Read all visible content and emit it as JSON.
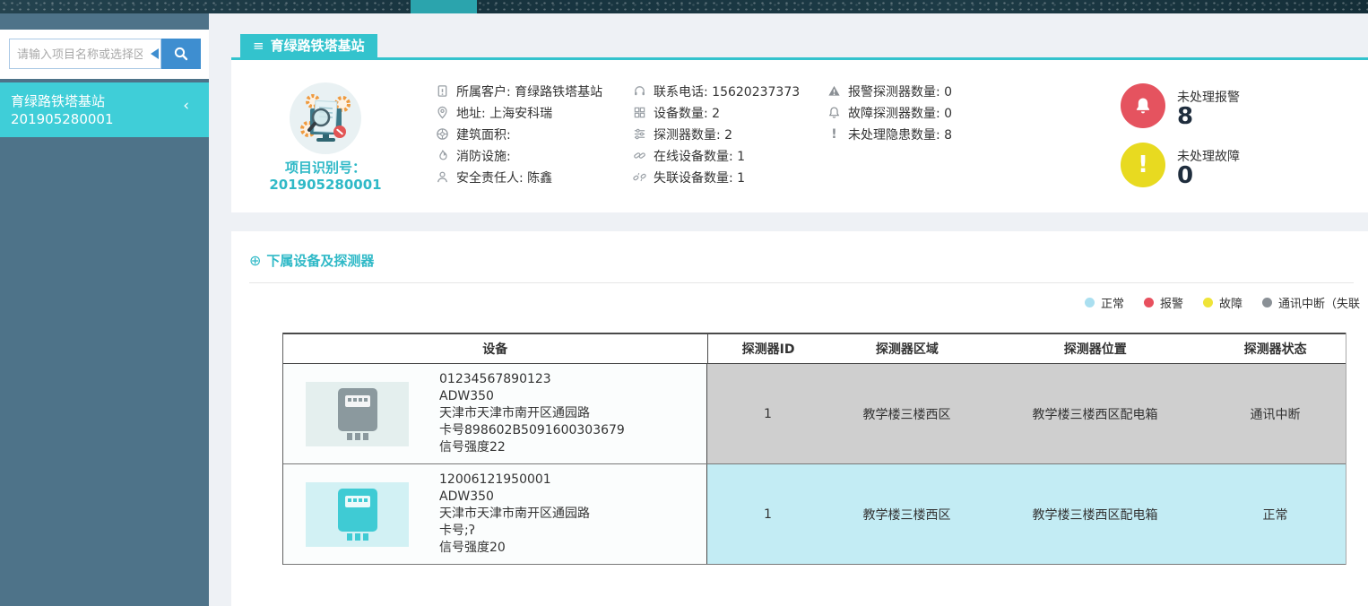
{
  "sidebar": {
    "search_placeholder": "请输入项目名称或选择区",
    "selected_project": {
      "name": "育绿路铁塔基站",
      "code": "201905280001",
      "chevron": "‹"
    }
  },
  "header": {
    "menu_icon": "≡",
    "tab_title": "育绿路铁塔基站"
  },
  "project": {
    "id_label": "项目识别号：",
    "id_value": "201905280001",
    "info_col1": [
      {
        "icon": "id-card-icon",
        "text": "所属客户: 育绿路铁塔基站"
      },
      {
        "icon": "location-pin-icon",
        "text": "地址: 上海安科瑞"
      },
      {
        "icon": "area-wheel-icon",
        "text": "建筑面积:"
      },
      {
        "icon": "fire-icon",
        "text": "消防设施:"
      },
      {
        "icon": "person-icon",
        "text": "安全责任人: 陈鑫"
      }
    ],
    "info_col2": [
      {
        "icon": "headset-icon",
        "text": "联系电话: 15620237373"
      },
      {
        "icon": "grid-icon",
        "text": "设备数量: 2"
      },
      {
        "icon": "sliders-icon",
        "text": "探测器数量: 2"
      },
      {
        "icon": "link-icon",
        "text": "在线设备数量: 1"
      },
      {
        "icon": "broken-link-icon",
        "text": "失联设备数量: 1"
      }
    ],
    "info_col3": [
      {
        "icon": "warning-triangle-icon",
        "text": "报警探测器数量: 0"
      },
      {
        "icon": "bell-outline-icon",
        "text": "故障探测器数量: 0"
      },
      {
        "icon": "exclamation-icon",
        "text": "未处理隐患数量: 8",
        "glyph": "!"
      }
    ]
  },
  "alerts": {
    "alarm_label": "未处理报警",
    "alarm_count": "8",
    "alarm_color": "#e5535f",
    "fault_label": "未处理故障",
    "fault_count": "0",
    "fault_color": "#e8da20",
    "fault_glyph": "!"
  },
  "devices_section": {
    "title": "下属设备及探测器",
    "title_icon": "⊕",
    "legend": [
      {
        "label": "正常",
        "color": "#aadff0"
      },
      {
        "label": "报警",
        "color": "#e8505e"
      },
      {
        "label": "故障",
        "color": "#efe438"
      },
      {
        "label": "通讯中断（失联",
        "color": "#8a9096"
      }
    ],
    "table": {
      "headers": [
        "设备",
        "探测器ID",
        "探测器区域",
        "探测器位置",
        "探测器状态"
      ],
      "rows": [
        {
          "device": {
            "line1": "01234567890123",
            "line2": "ADW350",
            "line3": "天津市天津市南开区通园路",
            "line4": "卡号898602B5091600303679",
            "line5": "信号强度22"
          },
          "detector": {
            "id": "1",
            "area": "教学楼三楼西区",
            "location": "教学楼三楼西区配电箱",
            "status": "通讯中断",
            "status_bg": "#cfcfcf"
          }
        },
        {
          "device": {
            "line1": "12006121950001",
            "line2": "ADW350",
            "line3": "天津市天津市南开区通园路",
            "line4": "卡号;ʔ",
            "line5": "信号强度20"
          },
          "detector": {
            "id": "1",
            "area": "教学楼三楼西区",
            "location": "教学楼三楼西区配电箱",
            "status": "正常",
            "status_bg": "#c3ecf4"
          }
        }
      ]
    }
  }
}
